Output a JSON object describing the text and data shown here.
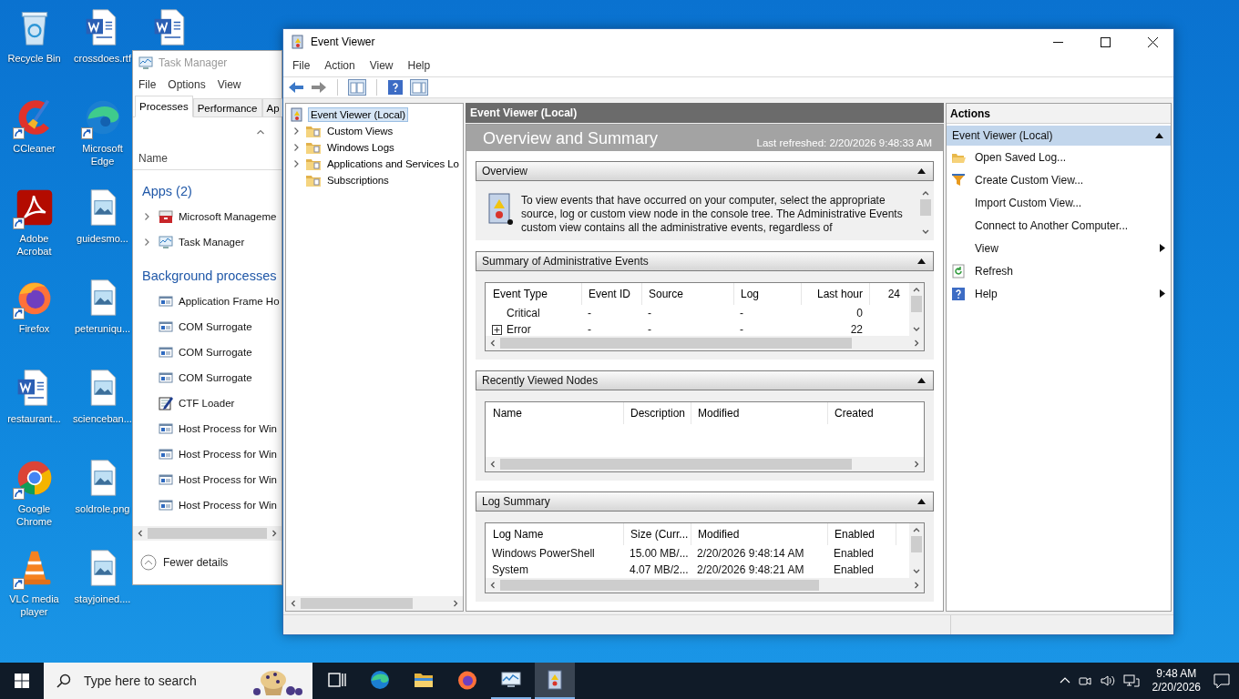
{
  "desktop": {
    "icons": [
      {
        "label": "Recycle Bin",
        "kind": "recycle",
        "shortcut": false
      },
      {
        "label": "CCleaner",
        "kind": "ccleaner",
        "shortcut": true
      },
      {
        "label": "Adobe Acrobat",
        "kind": "acrobat",
        "shortcut": true
      },
      {
        "label": "Firefox",
        "kind": "firefox",
        "shortcut": true
      },
      {
        "label": "restaurant...",
        "kind": "word",
        "shortcut": false
      },
      {
        "label": "Google Chrome",
        "kind": "chrome",
        "shortcut": true
      },
      {
        "label": "VLC media player",
        "kind": "vlc",
        "shortcut": true
      },
      {
        "label": "crossdoes.rtf",
        "kind": "word",
        "shortcut": false
      },
      {
        "label": "Microsoft Edge",
        "kind": "edge",
        "shortcut": true
      },
      {
        "label": "guidesmo...",
        "kind": "image",
        "shortcut": false
      },
      {
        "label": "peteruniqu...",
        "kind": "image",
        "shortcut": false
      },
      {
        "label": "scienceban...",
        "kind": "image",
        "shortcut": false
      },
      {
        "label": "soldrole.png",
        "kind": "image",
        "shortcut": false
      },
      {
        "label": "stayjoined....",
        "kind": "image",
        "shortcut": false
      },
      {
        "kind": "word",
        "shortcut": false
      }
    ]
  },
  "task_manager": {
    "title": "Task Manager",
    "menu": [
      "File",
      "Options",
      "View"
    ],
    "tabs": [
      {
        "label": "Processes",
        "selected": true
      },
      {
        "label": "Performance",
        "selected": false
      },
      {
        "label": "Ap",
        "selected": false
      }
    ],
    "column": "Name",
    "groups": [
      {
        "title": "Apps (2)",
        "items": [
          {
            "name": "Microsoft Manageme",
            "kind": "mmc",
            "expandable": true
          },
          {
            "name": "Task Manager",
            "kind": "taskmgr",
            "expandable": true
          }
        ]
      },
      {
        "title": "Background processes",
        "items": [
          {
            "name": "Application Frame Ho",
            "kind": "app",
            "expandable": false
          },
          {
            "name": "COM Surrogate",
            "kind": "app",
            "expandable": false
          },
          {
            "name": "COM Surrogate",
            "kind": "app",
            "expandable": false
          },
          {
            "name": "COM Surrogate",
            "kind": "app",
            "expandable": false
          },
          {
            "name": "CTF Loader",
            "kind": "ctf",
            "expandable": false
          },
          {
            "name": "Host Process for Win",
            "kind": "app",
            "expandable": false
          },
          {
            "name": "Host Process for Win",
            "kind": "app",
            "expandable": false
          },
          {
            "name": "Host Process for Win",
            "kind": "app",
            "expandable": false
          },
          {
            "name": "Host Process for Win",
            "kind": "app",
            "expandable": false
          }
        ]
      }
    ],
    "footer": "Fewer details"
  },
  "event_viewer": {
    "title": "Event Viewer",
    "menu": [
      "File",
      "Action",
      "View",
      "Help"
    ],
    "tree": {
      "label": "Event Viewer (Local)",
      "selected": true,
      "children": [
        {
          "label": "Custom Views",
          "expandable": true
        },
        {
          "label": "Windows Logs",
          "expandable": true
        },
        {
          "label": "Applications and Services Lo",
          "expandable": true
        },
        {
          "label": "Subscriptions",
          "expandable": false
        }
      ]
    },
    "center": {
      "header": "Event Viewer (Local)",
      "title": "Overview and Summary",
      "refreshed": "Last refreshed: 2/20/2026 9:48:33 AM",
      "sections": [
        {
          "title": "Overview",
          "kind": "text",
          "text": "To view events that have occurred on your computer, select the appropriate source, log or custom view node in the console tree. The Administrative Events custom view contains all the administrative events, regardless of"
        },
        {
          "title": "Summary of Administrative Events",
          "kind": "table",
          "columns": [
            "Event Type",
            "Event ID",
            "Source",
            "Log",
            "Last hour",
            "24"
          ],
          "rows": [
            {
              "expandable": false,
              "cells": [
                "Critical",
                "-",
                "-",
                "-",
                "0"
              ]
            },
            {
              "expandable": true,
              "cells": [
                "Error",
                "-",
                "-",
                "-",
                "22"
              ]
            }
          ]
        },
        {
          "title": "Recently Viewed Nodes",
          "kind": "table",
          "columns": [
            "Name",
            "Description",
            "Modified",
            "Created"
          ]
        },
        {
          "title": "Log Summary",
          "kind": "table",
          "columns": [
            "Log Name",
            "Size (Curr...",
            "Modified",
            "Enabled"
          ],
          "rows": [
            {
              "cells": [
                "Windows PowerShell",
                "15.00 MB/...",
                "2/20/2026 9:48:14 AM",
                "Enabled"
              ]
            },
            {
              "cells": [
                "System",
                "4.07 MB/2...",
                "2/20/2026 9:48:21 AM",
                "Enabled"
              ]
            }
          ]
        }
      ]
    },
    "actions": {
      "title": "Actions",
      "group": "Event Viewer (Local)",
      "items": [
        {
          "label": "Open Saved Log...",
          "kind": "open",
          "submenu": false
        },
        {
          "label": "Create Custom View...",
          "kind": "filter",
          "submenu": false
        },
        {
          "label": "Import Custom View...",
          "kind": "plain",
          "submenu": false
        },
        {
          "label": "Connect to Another Computer...",
          "kind": "plain",
          "submenu": false
        },
        {
          "label": "View",
          "kind": "plain",
          "submenu": true
        },
        {
          "label": "Refresh",
          "kind": "refresh",
          "submenu": false
        },
        {
          "label": "Help",
          "kind": "help",
          "submenu": true
        }
      ]
    }
  },
  "taskbar": {
    "search": {
      "placeholder": "Type here to search"
    },
    "apps": [
      {
        "kind": "taskview",
        "running": false,
        "selected": false
      },
      {
        "kind": "edge",
        "running": false,
        "selected": false
      },
      {
        "kind": "explorer",
        "running": false,
        "selected": false
      },
      {
        "kind": "firefox",
        "running": false,
        "selected": false
      },
      {
        "kind": "taskmgr",
        "running": true,
        "selected": false
      },
      {
        "kind": "eventviewer",
        "running": true,
        "selected": true
      }
    ],
    "time": "9:48 AM",
    "date": "2/20/2026"
  }
}
